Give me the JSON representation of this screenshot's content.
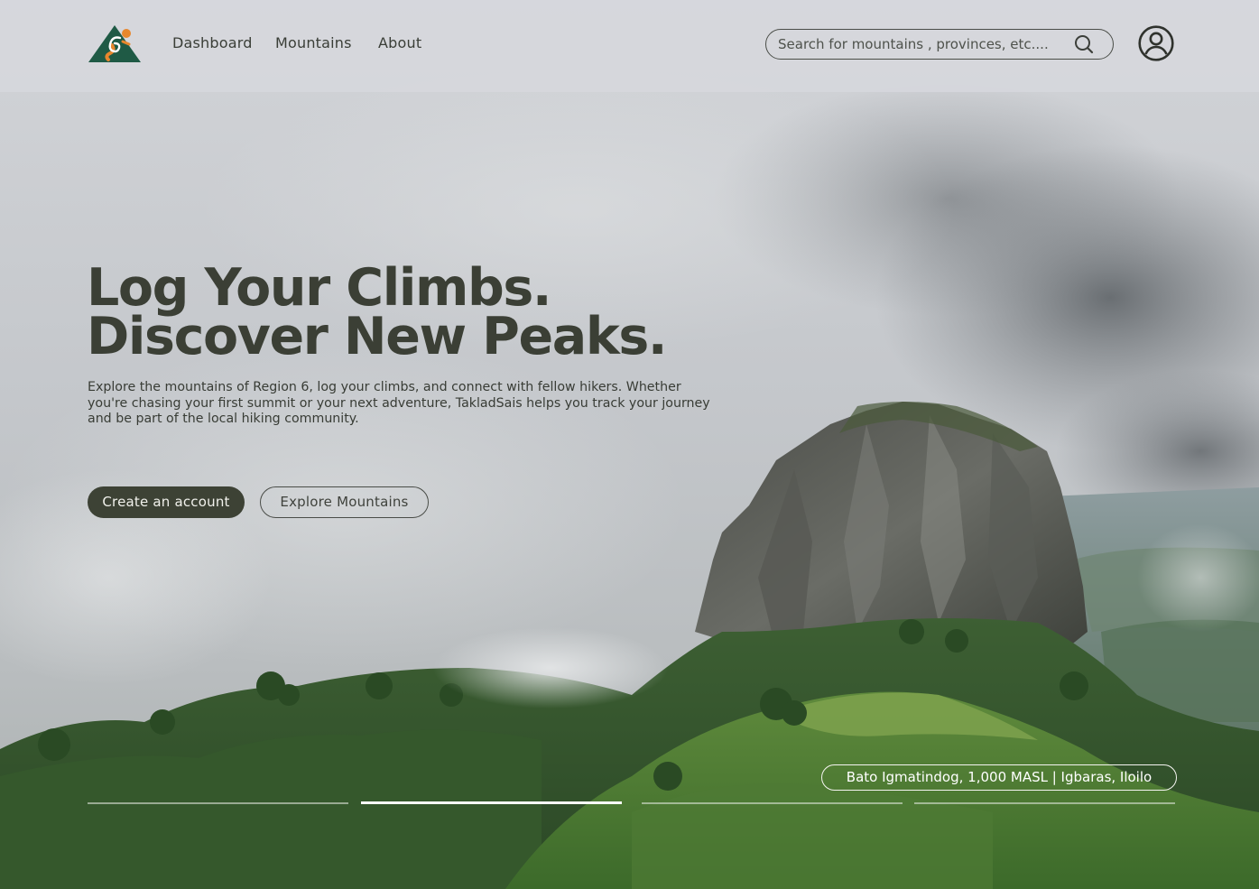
{
  "nav": {
    "logo_icon": "mountain-6-logo-icon",
    "links": [
      "Dashboard",
      "Mountains",
      "About"
    ]
  },
  "search": {
    "placeholder": "Search for mountains , provinces, etc....",
    "value": "",
    "icon": "search-icon"
  },
  "profile": {
    "icon": "user-circle-icon"
  },
  "hero": {
    "title_line1": "Log Your Climbs.",
    "title_line2": "Discover New Peaks.",
    "description": "Explore the mountains of Region 6, log your climbs, and connect with fellow hikers. Whether you're chasing your first summit or your next adventure, TakladSais helps you track your journey and be part of the local hiking community.",
    "primary_button": "Create an account",
    "secondary_button": "Explore Mountains"
  },
  "slide": {
    "caption": "Bato Igmatindog, 1,000 MASL | Igbaras, Iloilo",
    "count": 4,
    "active_index": 1
  },
  "colors": {
    "header_bg": "#d6d7dd",
    "primary_dark": "#3d4235",
    "logo_green": "#1f5a45",
    "logo_orange": "#e8872d",
    "text_dark": "#3b3f35"
  }
}
